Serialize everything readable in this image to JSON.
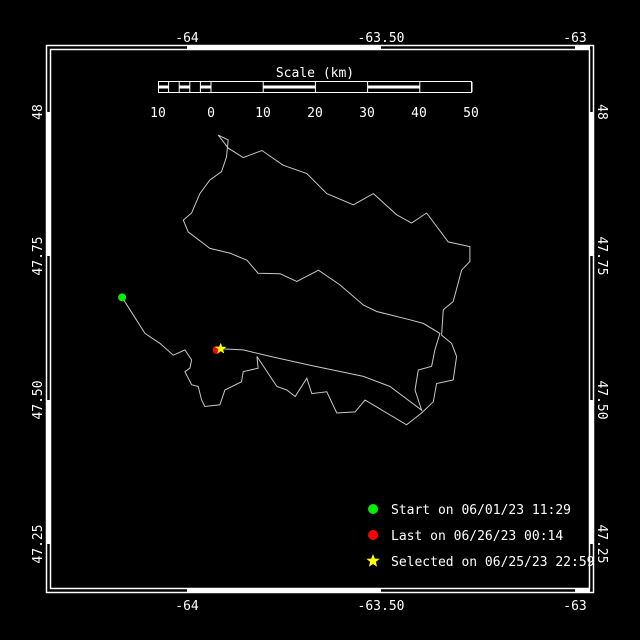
{
  "colors": {
    "background": "#000000",
    "frame": "#ffffff",
    "track": "#c8c8c8",
    "start": "#00ee00",
    "last": "#ff0000",
    "selected": "#ffff00"
  },
  "axes": {
    "lon_ticks": [
      {
        "value": -64,
        "label": "-64"
      },
      {
        "value": -63.5,
        "label": "-63.50"
      },
      {
        "value": -63,
        "label": "-63"
      }
    ],
    "lat_ticks": [
      {
        "value": 48,
        "label": "48"
      },
      {
        "value": 47.75,
        "label": "47.75"
      },
      {
        "value": 47.5,
        "label": "47.50"
      },
      {
        "value": 47.25,
        "label": "47.25"
      }
    ]
  },
  "scale_bar": {
    "title": "Scale (km)",
    "labels": [
      "10",
      "0",
      "10",
      "20",
      "30",
      "40",
      "50"
    ]
  },
  "legend": {
    "items": [
      {
        "marker": "green-circle",
        "label": "Start on 06/01/23 11:29"
      },
      {
        "marker": "red-circle",
        "label": "Last on 06/26/23 00:14"
      },
      {
        "marker": "yellow-star",
        "label": "Selected on 06/25/23 22:59"
      }
    ]
  },
  "chart_data": {
    "type": "map-track",
    "xlim": [
      -64.33,
      -62.95
    ],
    "ylim": [
      47.15,
      48.1
    ],
    "start": {
      "lon": -64.156,
      "lat": 47.679
    },
    "last": {
      "lon": -63.929,
      "lat": 47.59
    },
    "selected": {
      "lon": -63.919,
      "lat": 47.592
    },
    "track": [
      [
        -64.156,
        47.679
      ],
      [
        -64.137,
        47.658
      ],
      [
        -64.101,
        47.618
      ],
      [
        -64.065,
        47.601
      ],
      [
        -64.033,
        47.581
      ],
      [
        -64.005,
        47.59
      ],
      [
        -63.989,
        47.573
      ],
      [
        -63.993,
        47.559
      ],
      [
        -64.005,
        47.553
      ],
      [
        -63.989,
        47.531
      ],
      [
        -63.973,
        47.528
      ],
      [
        -63.965,
        47.505
      ],
      [
        -63.957,
        47.494
      ],
      [
        -63.921,
        47.497
      ],
      [
        -63.909,
        47.522
      ],
      [
        -63.869,
        47.536
      ],
      [
        -63.865,
        47.553
      ],
      [
        -63.829,
        47.559
      ],
      [
        -63.832,
        47.579
      ],
      [
        -63.784,
        47.528
      ],
      [
        -63.76,
        47.522
      ],
      [
        -63.74,
        47.511
      ],
      [
        -63.712,
        47.542
      ],
      [
        -63.7,
        47.516
      ],
      [
        -63.664,
        47.519
      ],
      [
        -63.64,
        47.483
      ],
      [
        -63.596,
        47.485
      ],
      [
        -63.572,
        47.505
      ],
      [
        -63.472,
        47.463
      ],
      [
        -63.436,
        47.483
      ],
      [
        -63.408,
        47.502
      ],
      [
        -63.4,
        47.533
      ],
      [
        -63.36,
        47.539
      ],
      [
        -63.352,
        47.579
      ],
      [
        -63.364,
        47.601
      ],
      [
        -63.388,
        47.615
      ],
      [
        -63.384,
        47.658
      ],
      [
        -63.36,
        47.672
      ],
      [
        -63.34,
        47.725
      ],
      [
        -63.32,
        47.74
      ],
      [
        -63.32,
        47.765
      ],
      [
        -63.372,
        47.773
      ],
      [
        -63.424,
        47.822
      ],
      [
        -63.46,
        47.805
      ],
      [
        -63.496,
        47.819
      ],
      [
        -63.552,
        47.855
      ],
      [
        -63.6,
        47.836
      ],
      [
        -63.664,
        47.855
      ],
      [
        -63.712,
        47.889
      ],
      [
        -63.769,
        47.903
      ],
      [
        -63.82,
        47.928
      ],
      [
        -63.865,
        47.916
      ],
      [
        -63.901,
        47.932
      ],
      [
        -63.925,
        47.954
      ],
      [
        -63.901,
        47.946
      ],
      [
        -63.905,
        47.917
      ],
      [
        -63.917,
        47.892
      ],
      [
        -63.945,
        47.878
      ],
      [
        -63.969,
        47.855
      ],
      [
        -63.989,
        47.822
      ],
      [
        -64.009,
        47.81
      ],
      [
        -63.997,
        47.79
      ],
      [
        -63.945,
        47.762
      ],
      [
        -63.897,
        47.754
      ],
      [
        -63.856,
        47.742
      ],
      [
        -63.829,
        47.72
      ],
      [
        -63.776,
        47.719
      ],
      [
        -63.736,
        47.706
      ],
      [
        -63.684,
        47.725
      ],
      [
        -63.632,
        47.7
      ],
      [
        -63.576,
        47.666
      ],
      [
        -63.544,
        47.655
      ],
      [
        -63.464,
        47.641
      ],
      [
        -63.432,
        47.635
      ],
      [
        -63.392,
        47.618
      ],
      [
        -63.404,
        47.59
      ],
      [
        -63.412,
        47.562
      ],
      [
        -63.444,
        47.556
      ],
      [
        -63.452,
        47.522
      ],
      [
        -63.436,
        47.488
      ],
      [
        -63.512,
        47.528
      ],
      [
        -63.576,
        47.545
      ],
      [
        -63.704,
        47.564
      ],
      [
        -63.8,
        47.579
      ],
      [
        -63.865,
        47.59
      ],
      [
        -63.921,
        47.592
      ]
    ]
  }
}
